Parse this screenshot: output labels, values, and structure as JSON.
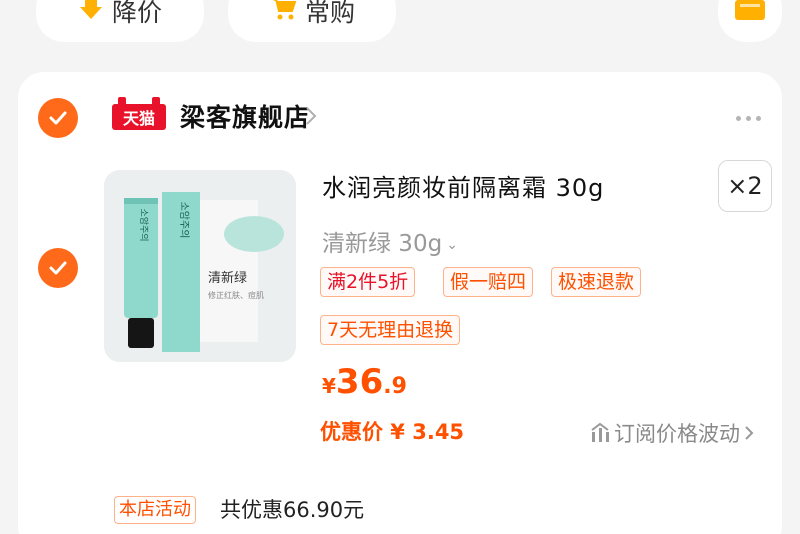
{
  "top_buttons": {
    "price_drop_label": "降价",
    "regular_buy_label": "常购"
  },
  "store": {
    "badge": "天猫",
    "name": "梁客旗舰店"
  },
  "item": {
    "image_brand_text_1": "소암주의",
    "image_brand_text_2": "소암주의",
    "image_color_name": "清新绿",
    "image_caption": "修正红肤、痘肌",
    "title": "水润亮颜妆前隔离霜 30g",
    "quantity": "×2",
    "variant": "清新绿 30g",
    "tags": [
      "满2件5折",
      "假一赔四",
      "极速退款",
      "7天无理由退换"
    ],
    "price": {
      "currency": "¥",
      "integer": "36",
      "decimal": ".9"
    },
    "discount_price": "优惠价 ¥ 3.45",
    "subscribe_label": "订阅价格波动"
  },
  "promo": {
    "tag": "本店活动",
    "text": "共优惠66.90元"
  },
  "colors": {
    "accent_orange": "#ff6a1a",
    "tmall_red": "#e8132a",
    "price_orange": "#ff5000",
    "tube_mint": "#8ed8cc"
  },
  "icons": [
    "price-drop-arrow-icon",
    "shopping-cart-icon",
    "folder-icon",
    "check-icon",
    "chevron-right-icon",
    "more-dots-icon",
    "chevron-down-icon",
    "price-trend-icon"
  ]
}
